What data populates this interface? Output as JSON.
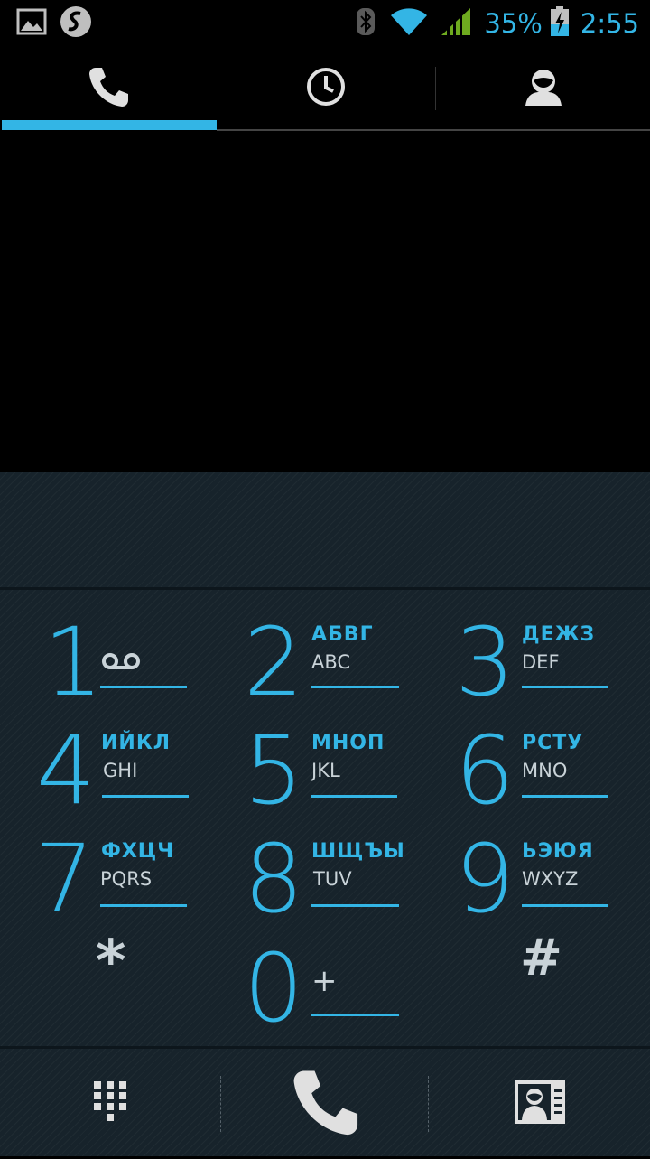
{
  "status_bar": {
    "left_icons": [
      "gallery-notification-icon",
      "swiftkey-notification-icon"
    ],
    "right_icons": [
      "bluetooth-icon",
      "wifi-icon",
      "signal-icon",
      "battery-charging-icon"
    ],
    "battery_percent": "35%",
    "time": "2:55"
  },
  "tabs": [
    {
      "icon": "phone-icon",
      "selected": true
    },
    {
      "icon": "recent-calls-icon",
      "selected": false
    },
    {
      "icon": "contacts-icon",
      "selected": false
    }
  ],
  "digits_field": {
    "value": ""
  },
  "keypad": {
    "k1": {
      "digit": "1",
      "voicemail_icon": "voicemail-icon"
    },
    "k2": {
      "digit": "2",
      "cyrillic": "АБВГ",
      "latin": "ABC"
    },
    "k3": {
      "digit": "3",
      "cyrillic": "ДЕЖЗ",
      "latin": "DEF"
    },
    "k4": {
      "digit": "4",
      "cyrillic": "ИЙКЛ",
      "latin": "GHI"
    },
    "k5": {
      "digit": "5",
      "cyrillic": "МНОП",
      "latin": "JKL"
    },
    "k6": {
      "digit": "6",
      "cyrillic": "РСТУ",
      "latin": "MNO"
    },
    "k7": {
      "digit": "7",
      "cyrillic": "ФХЦЧ",
      "latin": "PQRS"
    },
    "k8": {
      "digit": "8",
      "cyrillic": "ШЩЪЫ",
      "latin": "TUV"
    },
    "k9": {
      "digit": "9",
      "cyrillic": "ЬЭЮЯ",
      "latin": "WXYZ"
    },
    "kstar": {
      "symbol": "*"
    },
    "k0": {
      "digit": "0",
      "plus": "+"
    },
    "khash": {
      "symbol": "#"
    }
  },
  "bottom_bar": {
    "buttons": [
      "dialpad-icon",
      "call-icon",
      "contact-card-icon"
    ]
  },
  "colors": {
    "accent": "#33b5e5",
    "panel": "#17232b",
    "secondary_text": "#c9d3d8"
  }
}
